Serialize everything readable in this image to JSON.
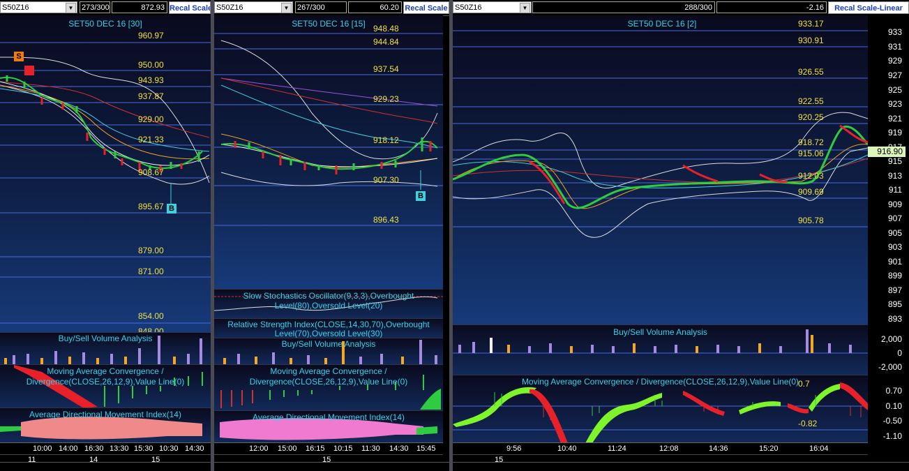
{
  "panels": [
    {
      "symbol": "S50Z16",
      "count": "273/300",
      "price": "872.93",
      "recal_label": "Recal Scale",
      "title": "SET50 DEC 16  [30]",
      "price_labels": [
        "960.97",
        "950.00",
        "943.93",
        "937.87",
        "929.00",
        "921.33",
        "908.67",
        "895.67",
        "879.00",
        "871.00",
        "854.00",
        "848.00"
      ],
      "buy_sell_title": "Buy/Sell Volume Analysis",
      "macd_title_1": "Moving Average Convergence /",
      "macd_title_2": "Divergence(CLOSE,26,12,9),Value Line(0)",
      "adx_title": "Average Directional Movement Index(14)",
      "times": [
        "10:00",
        "14:00",
        "16:30",
        "13:30",
        "15:30",
        "10:30",
        "14:30"
      ],
      "days": [
        "11",
        "14",
        "15"
      ],
      "sell_marker": "S",
      "buy_marker": "B"
    },
    {
      "symbol": "S50Z16",
      "count": "267/300",
      "price": "60.20",
      "recal_label": "Recal Scale",
      "title": "SET50 DEC 16   [15]",
      "price_labels": [
        "948.48",
        "944.84",
        "937.54",
        "929.23",
        "918.12",
        "907.30",
        "896.43"
      ],
      "stoch_title_1": "Slow Stochastics Oscillator(9,3,3),Overbought",
      "stoch_title_2": "Level(80),Oversold Level(20)",
      "rsi_title_1": "Relative Strength Index(CLOSE,14,30,70),Overbought",
      "rsi_title_2": "Level(70),Oversold Level(30)",
      "buy_sell_title": "Buy/Sell Volume Analysis",
      "macd_title_1": "Moving Average Convergence /",
      "macd_title_2": "Divergence(CLOSE,26,12,9),Value Line(0)",
      "adx_title": "Average Directional Movement Index(14)",
      "times": [
        "12:00",
        "15:00",
        "16:15",
        "10:15",
        "11:30",
        "14:30",
        "15:45"
      ],
      "days": [
        "15"
      ],
      "buy_marker": "B"
    },
    {
      "symbol": "S50Z16",
      "count": "288/300",
      "price": "-2.16",
      "recal_label": "Recal Scale-Linear",
      "title": "SET50 DEC 16   [2]",
      "price_labels": [
        "933.17",
        "930.91",
        "926.55",
        "922.55",
        "920.25",
        "918.72",
        "915.06",
        "912.03",
        "909.69",
        "905.78"
      ],
      "current_price": "916.90",
      "y_axis": [
        "933",
        "931",
        "929",
        "927",
        "925",
        "923",
        "921",
        "919",
        "917",
        "915",
        "913",
        "911",
        "909",
        "907",
        "905",
        "903",
        "901",
        "899",
        "897",
        "895",
        "893"
      ],
      "buy_sell_title": "Buy/Sell Volume Analysis",
      "vol_axis": [
        "2,000",
        "0",
        "-2,000"
      ],
      "macd_title": "Moving Average Convergence / Divergence(CLOSE,26,12,9),Value Line(0)",
      "macd_labels": [
        "0.7",
        "-0.82"
      ],
      "macd_axis": [
        "0.70",
        "0.10",
        "-0.50",
        "-1.10"
      ],
      "times": [
        "9:56",
        "10:40",
        "11:24",
        "12:08",
        "14:36",
        "15:20",
        "16:04"
      ],
      "days": [
        "15"
      ]
    }
  ],
  "colors": {
    "title": "#34d3e8",
    "price_label": "#f0e040",
    "recal": "#1c3cc8",
    "up_candle": "#2ecc40",
    "down_candle": "#e8202a",
    "volume_buy": "#f5a623",
    "volume_sell": "#a58be0"
  }
}
